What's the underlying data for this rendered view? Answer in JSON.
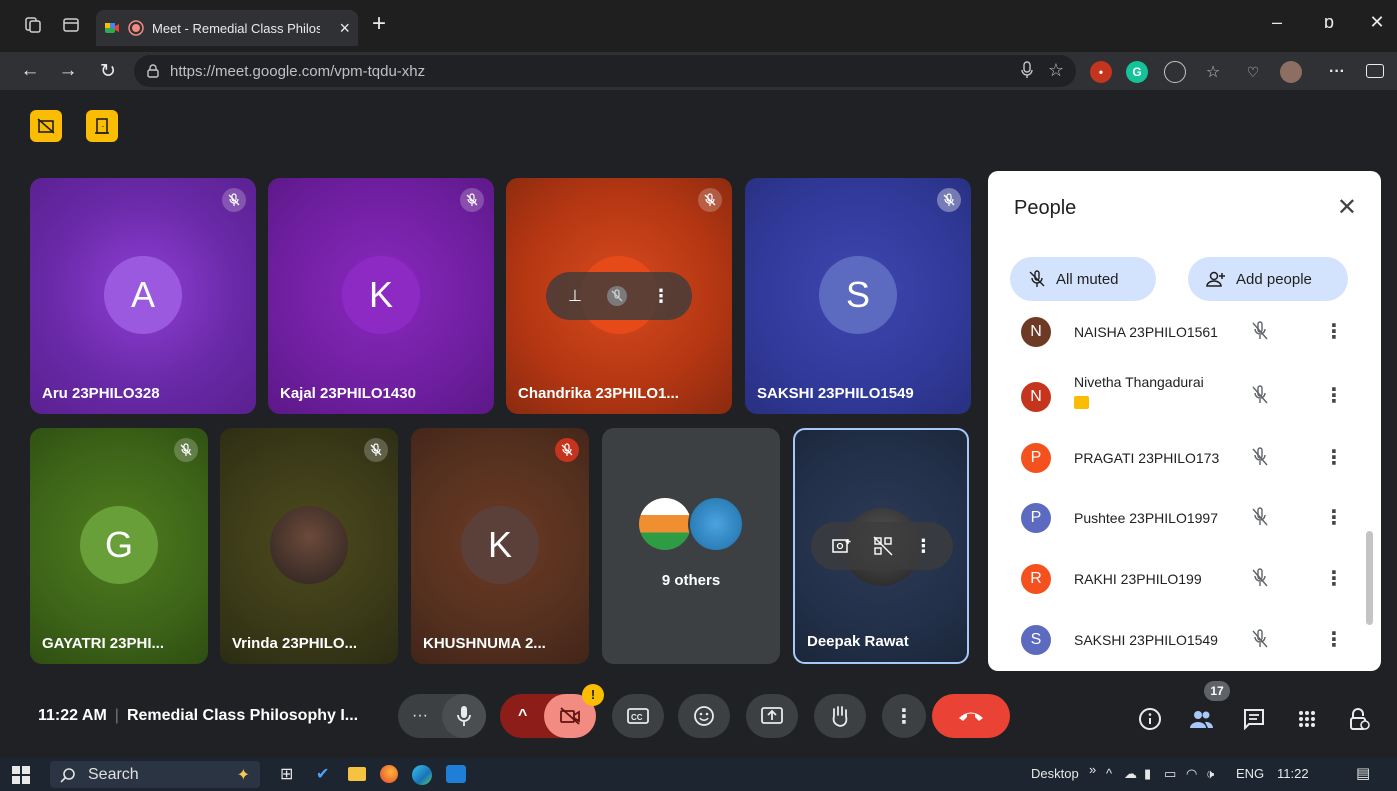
{
  "browser": {
    "tab_title": "Meet - Remedial Class Philos",
    "url_host": "https://meet.google.com",
    "url_path": "/vpm-tqdu-xhz"
  },
  "tiles_row1": [
    {
      "name": "Aru 23PHILO328",
      "initial": "A"
    },
    {
      "name": "Kajal 23PHILO1430",
      "initial": "K"
    },
    {
      "name": "Chandrika 23PHILO1...",
      "initial": ""
    },
    {
      "name": "SAKSHI 23PHILO1549",
      "initial": "S"
    }
  ],
  "tiles_row2": [
    {
      "name": "GAYATRI 23PHI...",
      "initial": "G"
    },
    {
      "name": "Vrinda 23PHILO...",
      "initial": ""
    },
    {
      "name": "KHUSHNUMA 2...",
      "initial": "K"
    },
    {
      "name": "",
      "initial": ""
    },
    {
      "name": "Deepak Rawat",
      "initial": ""
    }
  ],
  "others_label": "9 others",
  "people_panel": {
    "title": "People",
    "all_muted": "All muted",
    "add_people": "Add people",
    "people": [
      {
        "initial": "N",
        "name": "NAISHA 23PHILO1561",
        "color": "#6d3a25"
      },
      {
        "initial": "N",
        "name": "Nivetha Thangadurai",
        "color": "#c5341c"
      },
      {
        "initial": "P",
        "name": "PRAGATI 23PHILO173",
        "color": "#f4511e"
      },
      {
        "initial": "P",
        "name": "Pushtee 23PHILO1997",
        "color": "#5c6bc0"
      },
      {
        "initial": "R",
        "name": "RAKHI 23PHILO199",
        "color": "#f4511e"
      },
      {
        "initial": "S",
        "name": "SAKSHI 23PHILO1549",
        "color": "#5c6bc0"
      }
    ]
  },
  "meeting": {
    "time": "11:22 AM",
    "title": "Remedial Class Philosophy I...",
    "participant_count": "17",
    "alert_badge": "!"
  },
  "taskbar": {
    "search": "Search",
    "desktop": "Desktop",
    "lang": "ENG",
    "clock": "11:22"
  },
  "colors": {
    "end_call": "#ea4335",
    "camera_off": "#f28b82",
    "accent": "#fbbc04"
  }
}
